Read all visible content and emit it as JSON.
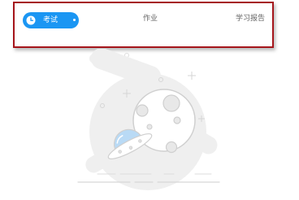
{
  "tabs": [
    {
      "label": "考试",
      "active": true,
      "icon": "clock-icon"
    },
    {
      "label": "作业",
      "active": false
    },
    {
      "label": "学习报告",
      "active": false
    }
  ],
  "colors": {
    "active_tab": "#1b96f3",
    "tabbar_border": "#a5151b",
    "tab_text": "#666666",
    "illustration_gray": "#efefef",
    "ufo_blue": "#b9daf5"
  },
  "empty_state": {
    "illustration": "planet-ufo-empty-icon"
  }
}
